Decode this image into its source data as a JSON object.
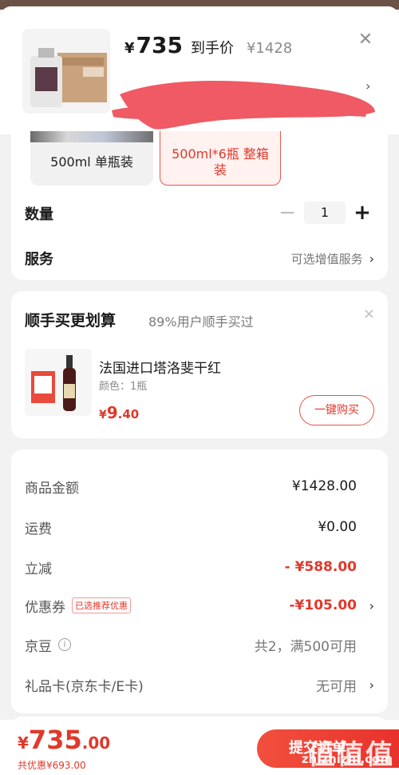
{
  "product": {
    "price_currency": "¥",
    "price_value": "735",
    "price_tag": "到手价",
    "orig_price": "¥1428"
  },
  "specs": [
    {
      "label": "500ml 单瓶装",
      "selected": false
    },
    {
      "label": "500ml*6瓶 整箱装",
      "selected": true
    }
  ],
  "quantity": {
    "label": "数量",
    "minus": "−",
    "value": "1",
    "plus": "+"
  },
  "service": {
    "label": "服务",
    "value": "可选增值服务",
    "chevron": "›"
  },
  "bundle": {
    "title": "顺手买更划算",
    "subtitle": "89%用户顺手买过",
    "close": "×",
    "item_name": "法国进口塔洛斐干红",
    "item_color": "颜色：1瓶",
    "item_price_currency": "¥",
    "item_price_int": "9",
    "item_price_dec": ".40",
    "buy_label": "一键购买"
  },
  "costs": [
    {
      "label": "商品金额",
      "value": "¥1428.00"
    },
    {
      "label": "运费",
      "value": "¥0.00"
    },
    {
      "label": "立减",
      "value": "- ¥588.00"
    },
    {
      "label": "优惠券",
      "badge": "已选推荐优惠",
      "value": "-¥105.00",
      "chevron": "›"
    },
    {
      "label": "京豆",
      "info": "i",
      "value": "共2，满500可用"
    },
    {
      "label": "礼品卡(京东卡/E卡)",
      "value": "无可用",
      "chevron": "›"
    }
  ],
  "total": {
    "currency": "¥",
    "int": "735",
    "dec": ".00",
    "saving": "共优惠¥693.00"
  },
  "submit_label": "提交订单",
  "watermark": {
    "text": "值值值",
    "url": "zhizhizhi.com"
  },
  "colors": {
    "accent": "#e0392b",
    "redaction": "#ef5a64"
  }
}
